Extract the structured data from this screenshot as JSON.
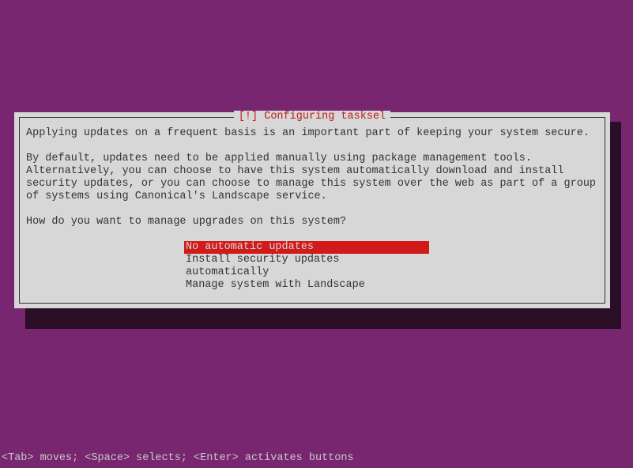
{
  "dialog": {
    "title": "[!] Configuring tasksel",
    "para1": "Applying updates on a frequent basis is an important part of keeping your system secure.",
    "para2": "By default, updates need to be applied manually using package management tools. Alternatively, you can choose to have this system automatically download and install security updates, or you can choose to manage this system over the web as part of a group of systems using Canonical's Landscape service.",
    "question": "How do you want to manage upgrades on this system?",
    "options": [
      {
        "label": "No automatic updates",
        "selected": true
      },
      {
        "label": "Install security updates automatically",
        "selected": false
      },
      {
        "label": "Manage system with Landscape",
        "selected": false
      }
    ]
  },
  "helpbar": "<Tab> moves; <Space> selects; <Enter> activates buttons"
}
